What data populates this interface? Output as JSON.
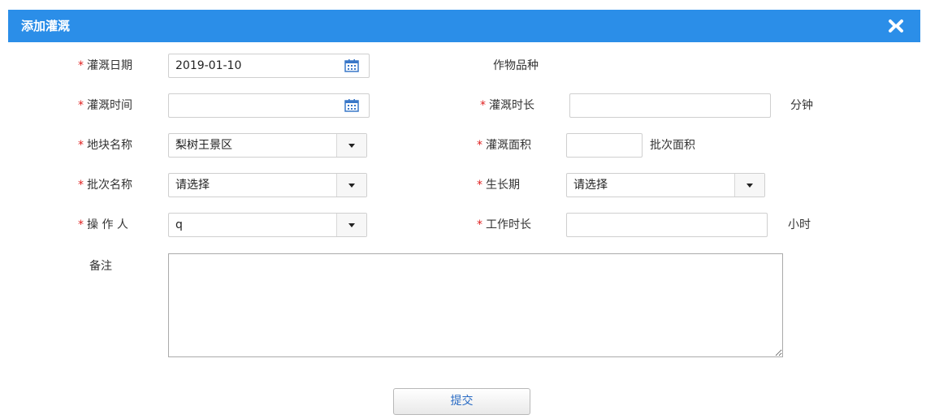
{
  "dialog": {
    "title": "添加灌溉",
    "close_icon": "close-icon"
  },
  "form": {
    "irrigation_date": {
      "label": "灌溉日期",
      "value": "2019-01-10",
      "required": true
    },
    "crop_variety": {
      "label": "作物品种"
    },
    "irrigation_time": {
      "label": "灌溉时间",
      "value": "",
      "required": true
    },
    "irrigation_duration": {
      "label": "灌溉时长",
      "value": "",
      "unit": "分钟",
      "required": true
    },
    "plot_name": {
      "label": "地块名称",
      "value": "梨树王景区",
      "required": true
    },
    "irrigation_area": {
      "label": "灌溉面积",
      "value": "",
      "unit": "批次面积",
      "required": true
    },
    "batch_name": {
      "label": "批次名称",
      "value": "请选择",
      "required": true
    },
    "growth_stage": {
      "label": "生长期",
      "value": "请选择",
      "required": true
    },
    "operator": {
      "label": "操 作 人",
      "value": "q",
      "required": true
    },
    "work_duration": {
      "label": "工作时长",
      "value": "",
      "unit": "小时",
      "required": true
    },
    "remarks": {
      "label": "备注",
      "value": ""
    }
  },
  "required_mark": "*",
  "submit_label": "提交",
  "colors": {
    "title_bar": "#2b8ee8",
    "required": "#e02020",
    "submit_text": "#2b6cc4"
  }
}
